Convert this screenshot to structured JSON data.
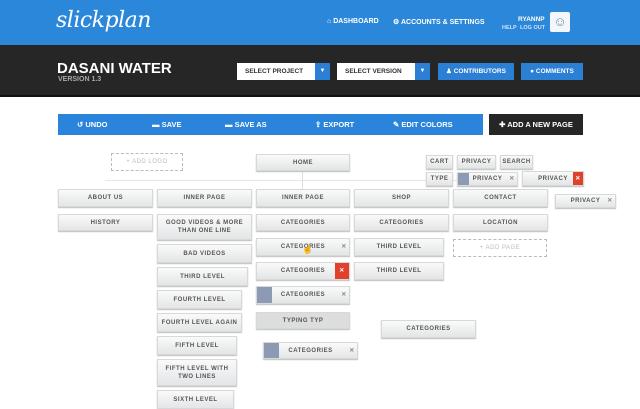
{
  "header": {
    "logo": "slickplan",
    "dashboard": "DASHBOARD",
    "accounts": "ACCOUNTS & SETTINGS",
    "user": "RYANNP",
    "help": "HELP",
    "logout": "LOG OUT"
  },
  "project": {
    "title": "DASANI WATER",
    "version": "VERSION 1.3",
    "select_project": "SELECT PROJECT",
    "select_version": "SELECT VERSION",
    "contributors": "CONTRIBUTORS",
    "comments": "COMMENTS"
  },
  "toolbar": {
    "undo": "UNDO",
    "save": "SAVE",
    "save_as": "SAVE AS",
    "export": "EXPORT",
    "edit_colors": "EDIT COLORS",
    "add_page": "ADD A NEW PAGE"
  },
  "canvas": {
    "add_logo": "+ ADD LOGO",
    "home": "HOME",
    "add_page": "+ ADD PAGE",
    "utility": [
      "CART",
      "PRIVACY",
      "SEARCH",
      "TYPE",
      "PRIVACY",
      "PRIVACY",
      "PRIVACY"
    ],
    "col1": [
      "ABOUT US",
      "HISTORY"
    ],
    "col2": [
      "INNER PAGE",
      "GOOD VIDEOS & MORE THAN ONE LINE",
      "BAD VIDEOS",
      "THIRD LEVEL",
      "FOURTH LEVEL",
      "FOURTH LEVEL AGAIN",
      "FIFTH LEVEL",
      "FIFTH LEVEL WITH TWO LINES",
      "SIXTH LEVEL"
    ],
    "col3": [
      "INNER PAGE",
      "CATEGORIES",
      "CATEGORIES",
      "CATEGORIES",
      "CATEGORIES",
      "TYPING TYP",
      "CATEGORIES"
    ],
    "col4": [
      "SHOP",
      "CATEGORIES",
      "THIRD LEVEL",
      "THIRD LEVEL",
      "CATEGORIES"
    ],
    "col5": [
      "CONTACT",
      "LOCATION"
    ]
  }
}
